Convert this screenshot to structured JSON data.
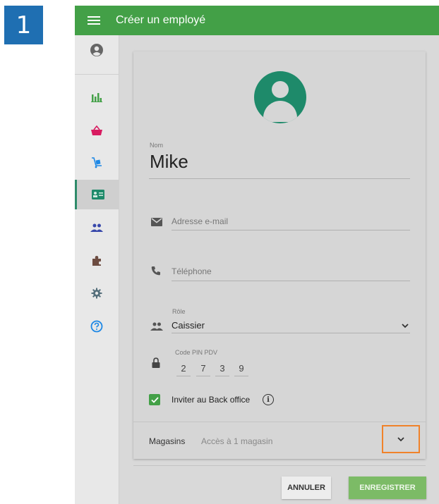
{
  "step": "1",
  "header": {
    "title": "Créer un employé"
  },
  "sidebar": {
    "items": [
      {
        "icon": "account-circle-icon"
      },
      {
        "icon": "bar-chart-icon",
        "color": "#43a047"
      },
      {
        "icon": "basket-icon",
        "color": "#d81b60"
      },
      {
        "icon": "cart-icon",
        "color": "#1e88e5"
      },
      {
        "icon": "employee-badge-icon",
        "color": "#1e8a6a",
        "active": true
      },
      {
        "icon": "people-icon",
        "color": "#3949ab"
      },
      {
        "icon": "puzzle-icon",
        "color": "#6d4c41"
      },
      {
        "icon": "gear-icon",
        "color": "#546e7a"
      },
      {
        "icon": "help-icon",
        "color": "#1e88e5"
      }
    ]
  },
  "form": {
    "name_label": "Nom",
    "name_value": "Mike",
    "email_placeholder": "Adresse e-mail",
    "phone_placeholder": "Téléphone",
    "role_label": "Rôle",
    "role_value": "Caissier",
    "pin_label": "Code PIN PDV",
    "pin_digits": [
      "2",
      "7",
      "3",
      "9"
    ],
    "invite_label": "Inviter au Back office",
    "invite_checked": true,
    "stores_label": "Magasins",
    "stores_value": "Accès à 1 magasin"
  },
  "actions": {
    "cancel_label": "ANNULER",
    "save_label": "ENREGISTRER"
  },
  "colors": {
    "accent": "#43a047",
    "highlight": "#f0822a",
    "avatar": "#1e8a6a"
  }
}
